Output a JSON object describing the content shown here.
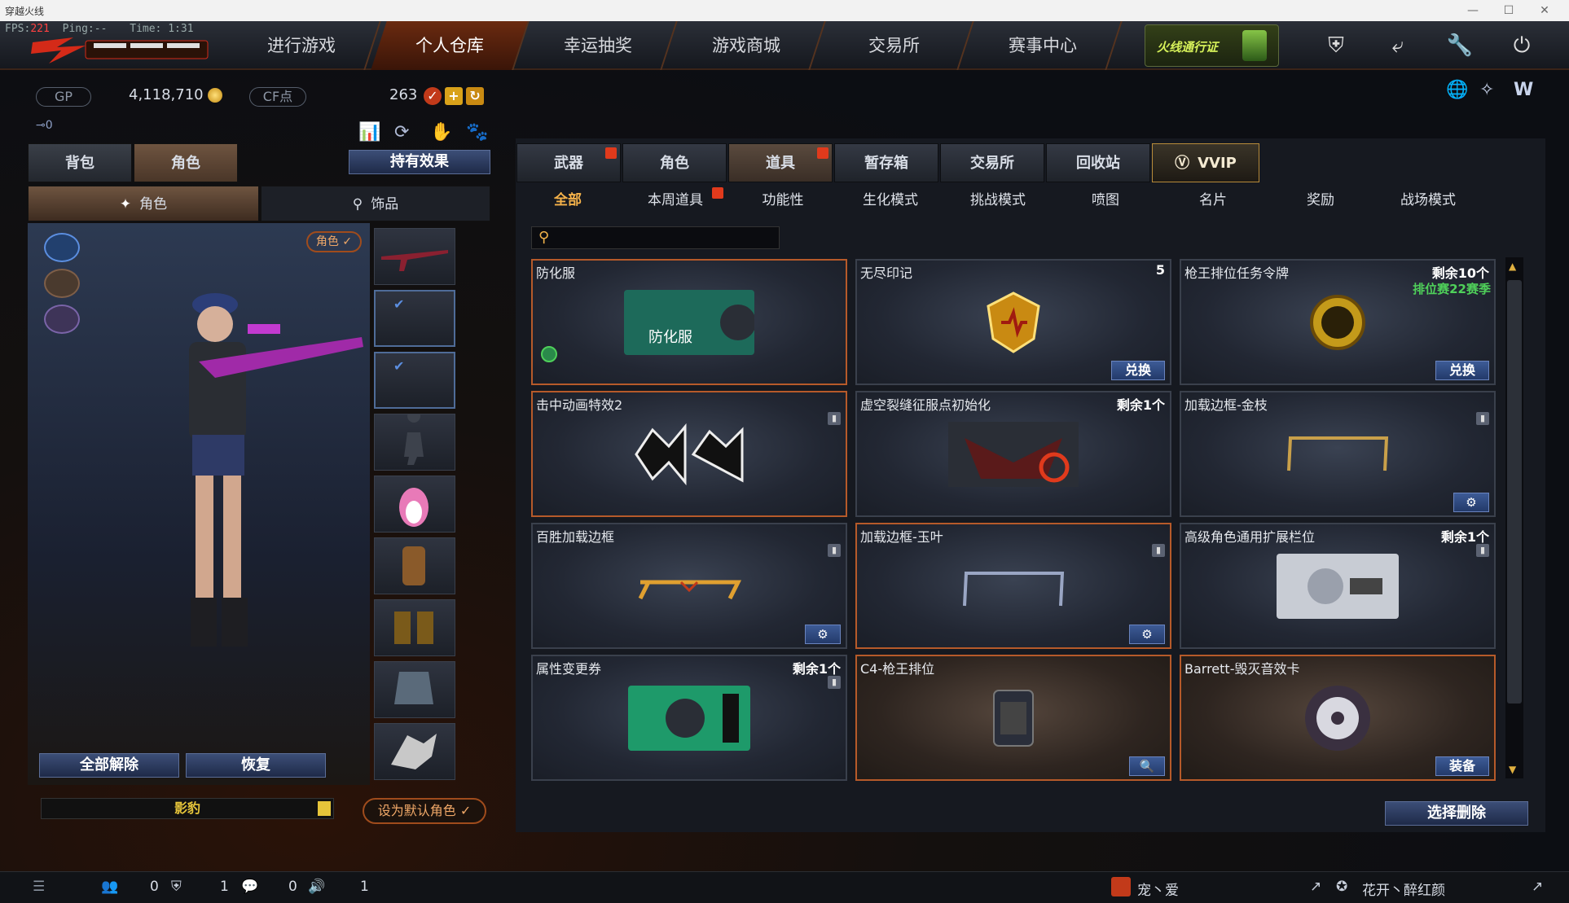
{
  "window": {
    "title": "穿越火线"
  },
  "stats": {
    "fps_label": "FPS:",
    "fps_value": "221",
    "ping": "Ping:--",
    "time": "Time: 1:31"
  },
  "nav": {
    "items": [
      "进行游戏",
      "个人仓库",
      "幸运抽奖",
      "游戏商城",
      "交易所",
      "赛事中心"
    ],
    "active_index": 1,
    "pass_label": "火线通行证",
    "icons": [
      "shield-icon",
      "return-icon",
      "wrench-icon",
      "power-icon"
    ]
  },
  "currency": {
    "gp_label": "GP",
    "gp_value": "4,118,710",
    "cf_label": "CF点",
    "cf_value": "263"
  },
  "left": {
    "tabs": [
      "背包",
      "角色"
    ],
    "effect_button": "持有效果",
    "subtabs": [
      "角色",
      "饰品"
    ],
    "badge": "角色 ✓",
    "clear_button": "全部解除",
    "restore_button": "恢复",
    "character_name": "影豹",
    "default_button": "设为默认角色 ✓"
  },
  "right": {
    "categories": [
      "武器",
      "角色",
      "道具",
      "暂存箱",
      "交易所",
      "回收站",
      "VVIP"
    ],
    "active_category": 2,
    "subcategories": [
      "全部",
      "本周道具",
      "功能性",
      "生化模式",
      "挑战模式",
      "喷图",
      "名片",
      "奖励",
      "战场模式"
    ],
    "active_sub": 0,
    "art_label": "防化服",
    "cards": [
      {
        "name": "防化服",
        "count": "",
        "sub": "",
        "action": "",
        "style": "hl"
      },
      {
        "name": "无尽印记",
        "count": "5",
        "sub": "",
        "action": "兑换",
        "style": ""
      },
      {
        "name": "枪王排位任务令牌",
        "count": "剩余10个",
        "sub": "排位赛22赛季",
        "action": "兑换",
        "style": ""
      },
      {
        "name": "击中动画特效2",
        "count": "",
        "sub": "",
        "action": "",
        "style": "hl"
      },
      {
        "name": "虚空裂缝征服点初始化",
        "count": "剩余1个",
        "sub": "",
        "action": "",
        "style": ""
      },
      {
        "name": "加载边框-金枝",
        "count": "",
        "sub": "",
        "action": "⚙",
        "style": ""
      },
      {
        "name": "百胜加载边框",
        "count": "",
        "sub": "",
        "action": "⚙",
        "style": ""
      },
      {
        "name": "加载边框-玉叶",
        "count": "",
        "sub": "",
        "action": "⚙",
        "style": "hl"
      },
      {
        "name": "高级角色通用扩展栏位",
        "count": "剩余1个",
        "sub": "",
        "action": "",
        "style": ""
      },
      {
        "name": "属性变更券",
        "count": "剩余1个",
        "sub": "",
        "action": "",
        "style": ""
      },
      {
        "name": "C4-枪王排位",
        "count": "",
        "sub": "",
        "action": "🔍",
        "style": "brown"
      },
      {
        "name": "Barrett-毁灭音效卡",
        "count": "",
        "sub": "",
        "action": "装备",
        "style": "brown"
      }
    ],
    "delete_button": "选择删除"
  },
  "footer": {
    "count1": "0",
    "count2": "1",
    "count3": "0",
    "count4": "1",
    "friend1": "宠丶爱",
    "friend2": "花开丶醉红颜"
  }
}
